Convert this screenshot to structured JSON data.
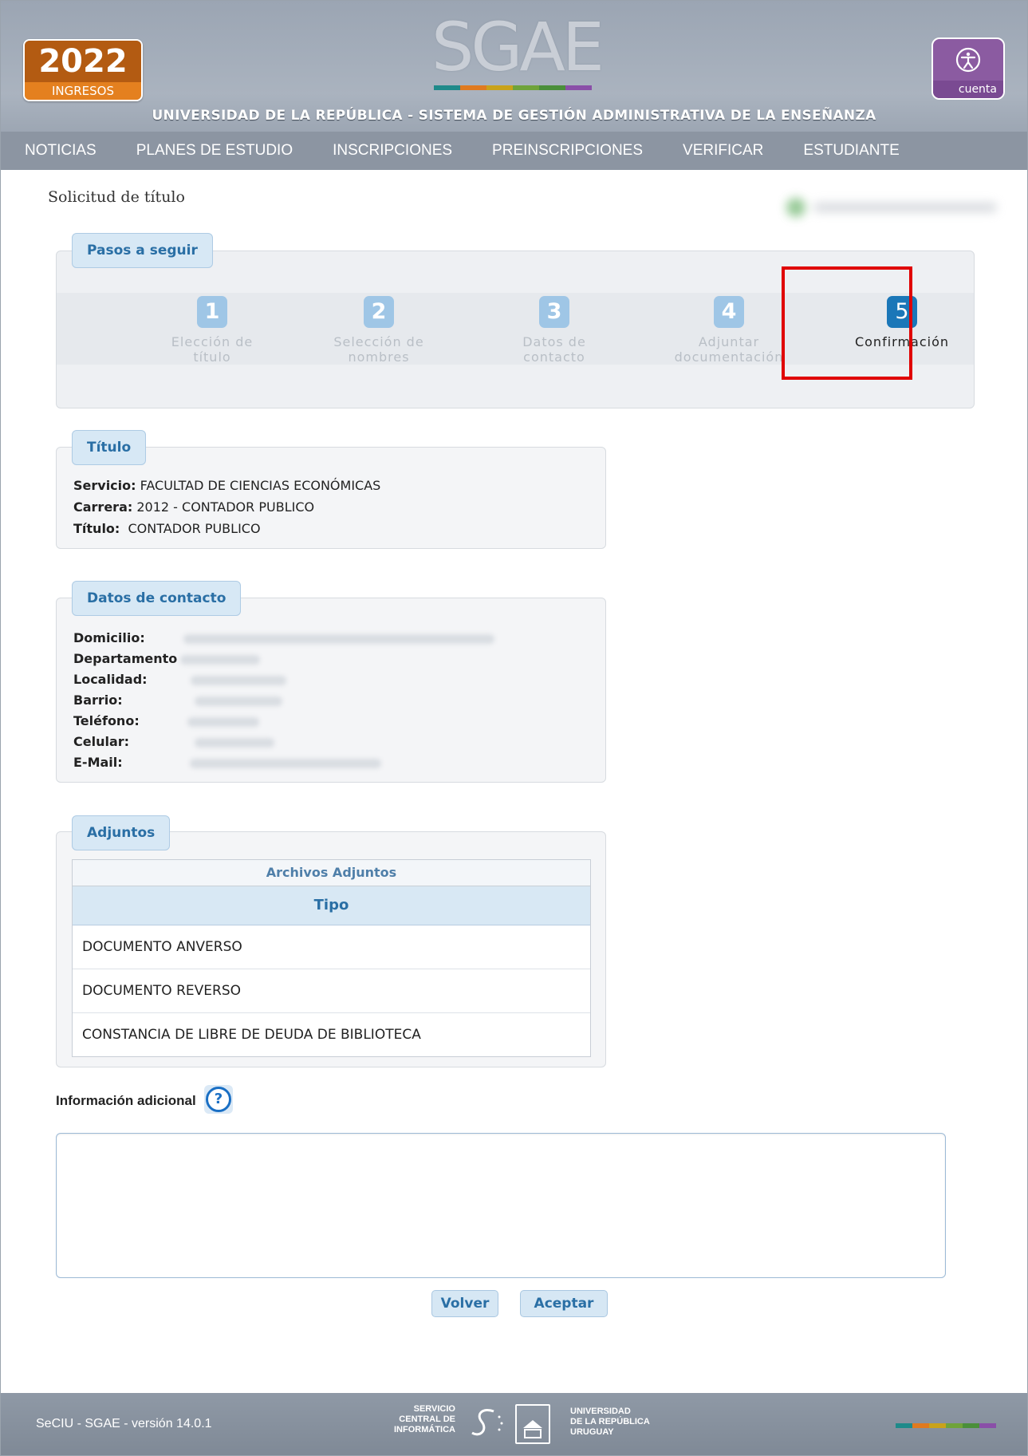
{
  "header": {
    "year": "2022",
    "year_sub": "INGRESOS",
    "app_logo": "SGAE",
    "account_label": "cuenta",
    "university_line": "UNIVERSIDAD DE LA REPÚBLICA - SISTEMA DE GESTIÓN ADMINISTRATIVA DE LA ENSEÑANZA",
    "brand_colors": [
      "#1f8a8a",
      "#e07a1f",
      "#c9a21a",
      "#6fa33a",
      "#4a8f3a",
      "#8a4fa8"
    ]
  },
  "nav": {
    "items": [
      "NOTICIAS",
      "PLANES DE ESTUDIO",
      "INSCRIPCIONES",
      "PREINSCRIPCIONES",
      "VERIFICAR",
      "ESTUDIANTE"
    ]
  },
  "page": {
    "title": "Solicitud de título"
  },
  "steps": {
    "heading": "Pasos a seguir",
    "items": [
      {
        "num": "1",
        "line1": "Elección de",
        "line2": "título"
      },
      {
        "num": "2",
        "line1": "Selección de",
        "line2": "nombres"
      },
      {
        "num": "3",
        "line1": "Datos de",
        "line2": "contacto"
      },
      {
        "num": "4",
        "line1": "Adjuntar",
        "line2": "documentación"
      },
      {
        "num": "5",
        "line1": "Confirmación",
        "line2": ""
      }
    ],
    "active_step": 5
  },
  "titulo": {
    "heading": "Título",
    "servicio_label": "Servicio:",
    "servicio": "FACULTAD DE CIENCIAS ECONÓMICAS",
    "carrera_label": "Carrera:",
    "carrera": "2012 - CONTADOR PUBLICO",
    "titulo_label": "Título:",
    "titulo": "CONTADOR PUBLICO"
  },
  "contacto": {
    "heading": "Datos de contacto",
    "labels": [
      "Domicilio:",
      "Departamento",
      "Localidad:",
      "Barrio:",
      "Teléfono:",
      "Celular:",
      "E-Mail:"
    ]
  },
  "adjuntos": {
    "heading": "Adjuntos",
    "table_caption": "Archivos Adjuntos",
    "column": "Tipo",
    "rows": [
      "DOCUMENTO ANVERSO",
      "DOCUMENTO REVERSO",
      "CONSTANCIA DE LIBRE DE DEUDA DE BIBLIOTECA"
    ]
  },
  "info": {
    "label": "Información adicional",
    "help_glyph": "?",
    "value": ""
  },
  "buttons": {
    "back": "Volver",
    "accept": "Aceptar"
  },
  "footer": {
    "version": "SeCIU - SGAE - versión 14.0.1",
    "sci": [
      "SERVICIO",
      "CENTRAL DE",
      "INFORMÁTICA"
    ],
    "udelar": [
      "UNIVERSIDAD",
      "DE LA REPÚBLICA",
      "URUGUAY"
    ]
  }
}
